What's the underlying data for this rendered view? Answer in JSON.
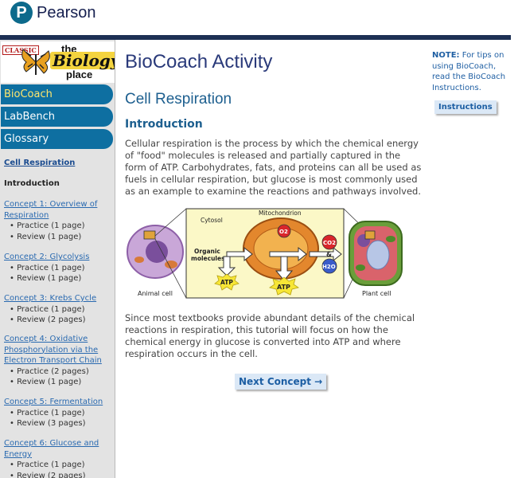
{
  "header": {
    "logo_letter": "P",
    "logo_text": "Pearson"
  },
  "brand": {
    "classic": "CLASSIC",
    "the": "the",
    "biology": "Biology",
    "place": "place"
  },
  "nav": [
    {
      "label": "BioCoach"
    },
    {
      "label": "LabBench"
    },
    {
      "label": "Glossary"
    }
  ],
  "toc": {
    "current": "Cell Respiration",
    "intro": "Introduction",
    "concepts": [
      {
        "title": "Concept 1: Overview of Respiration",
        "items": [
          "Practice (1 page)",
          "Review (1 page)"
        ]
      },
      {
        "title": "Concept 2: Glycolysis",
        "items": [
          "Practice (1 page)",
          "Review (1 page)"
        ]
      },
      {
        "title": "Concept 3: Krebs Cycle",
        "items": [
          "Practice (1 page)",
          "Review (2 pages)"
        ]
      },
      {
        "title": "Concept 4: Oxidative Phosphorylation via the Electron Transport Chain",
        "items": [
          "Practice (2 pages)",
          "Review (1 page)"
        ]
      },
      {
        "title": "Concept 5: Fermentation",
        "items": [
          "Practice (1 page)",
          "Review (3 pages)"
        ]
      },
      {
        "title": "Concept 6: Glucose and Energy",
        "items": [
          "Practice (1 page)",
          "Review (2 pages)"
        ]
      }
    ]
  },
  "main": {
    "activity_title": "BioCoach Activity",
    "section_title": "Cell Respiration",
    "sub_title": "Introduction",
    "para1": "Cellular respiration is the process by which the chemical energy of \"food\" molecules is released and partially captured in the form of ATP. Carbohydrates, fats, and proteins can all be used as fuels in cellular respiration, but glucose is most commonly used as an example to examine the reactions and pathways involved.",
    "para2": "Since most textbooks provide abundant details of the chemical reactions in respiration, this tutorial will focus on how the chemical energy in glucose is converted into ATP and where respiration occurs in the cell.",
    "next_label": "Next Concept →"
  },
  "figure": {
    "animal_label": "Animal cell",
    "plant_label": "Plant cell",
    "cytosol": "Cytosol",
    "mitochondrion": "Mitochondrion",
    "organic1": "Organic",
    "organic2": "molecules",
    "atp": "ATP",
    "o2": "O2",
    "co2": "CO2",
    "amp": "&",
    "h2o": "H2O"
  },
  "note": {
    "bold": "NOTE:",
    "text": " For tips on using BioCoach, read the BioCoach Instructions.",
    "button": "Instructions"
  }
}
